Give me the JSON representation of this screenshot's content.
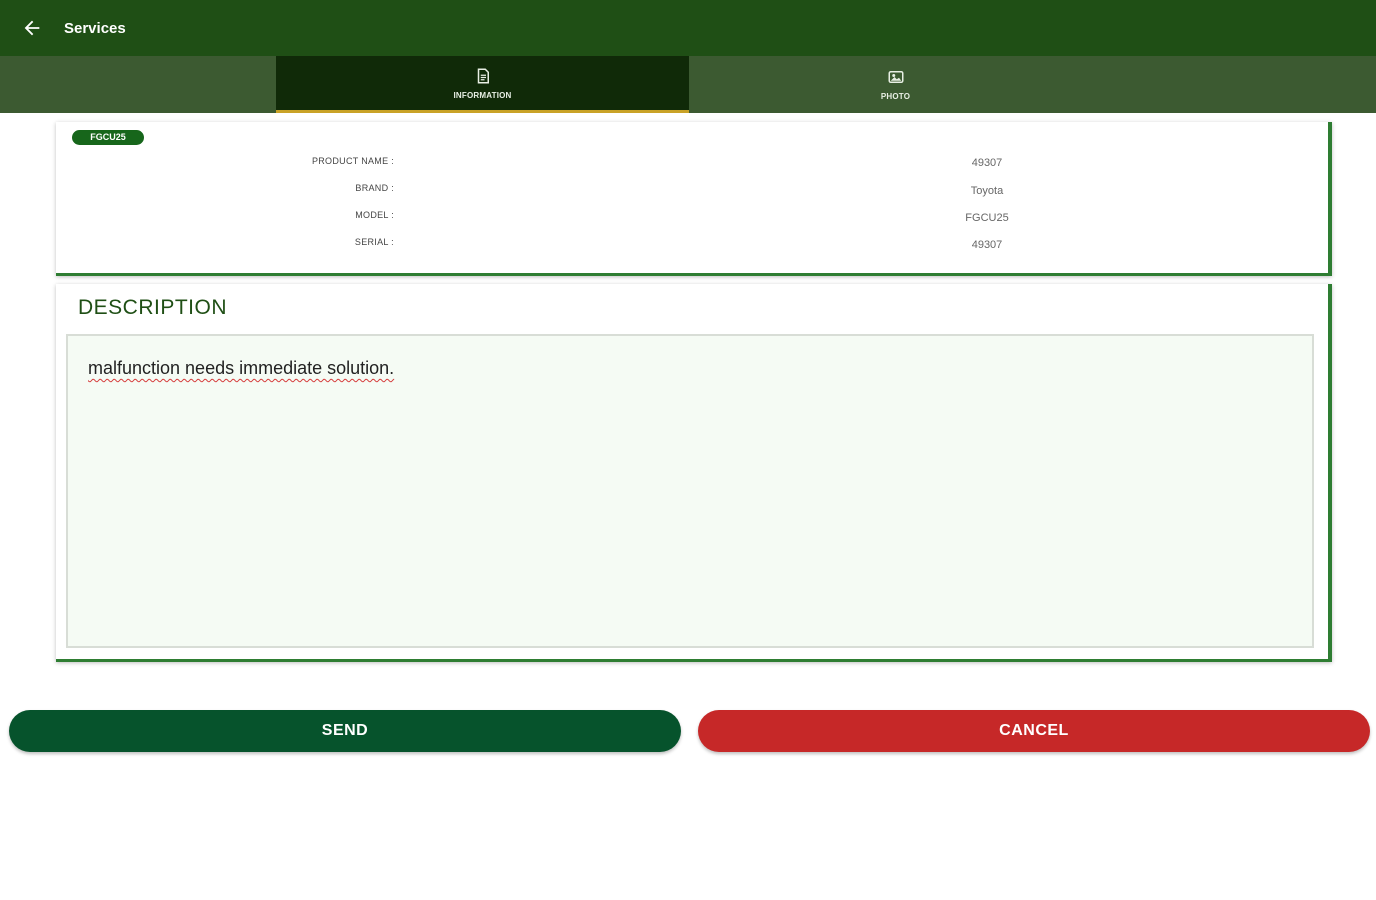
{
  "appbar": {
    "title": "Services",
    "back_icon": "arrow-left-icon"
  },
  "tabs": [
    {
      "label": "INFORMATION",
      "icon": "document-icon",
      "active": true
    },
    {
      "label": "PHOTO",
      "icon": "image-icon",
      "active": false
    }
  ],
  "info": {
    "badge": "FGCU25",
    "rows": [
      {
        "label": "PRODUCT NAME :",
        "value": "49307"
      },
      {
        "label": "BRAND :",
        "value": "Toyota"
      },
      {
        "label": "MODEL :",
        "value": "FGCU25"
      },
      {
        "label": "SERIAL :",
        "value": "49307"
      }
    ]
  },
  "description": {
    "title": "DESCRIPTION",
    "text": "malfunction needs immediate solution."
  },
  "actions": {
    "send_label": "SEND",
    "cancel_label": "CANCEL"
  },
  "colors": {
    "appbar": "#1f4f15",
    "tabbar": "#3c5a31",
    "tab_active": "#102a08",
    "indicator": "#c9a227",
    "send": "#06532c",
    "cancel": "#c62828",
    "accent": "#2e7d32"
  }
}
